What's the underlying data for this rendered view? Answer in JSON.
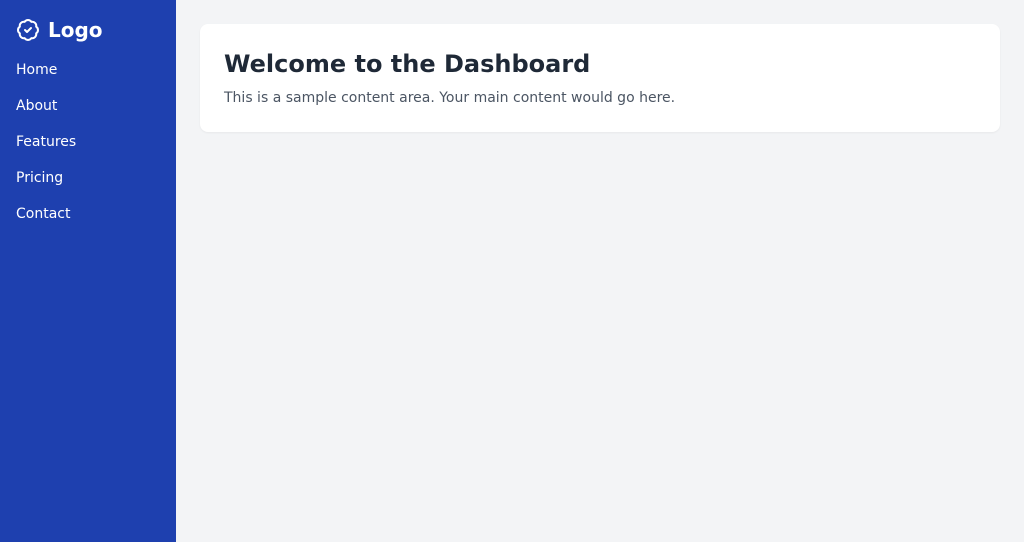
{
  "brand": {
    "label": "Logo"
  },
  "sidebar": {
    "items": [
      {
        "label": "Home"
      },
      {
        "label": "About"
      },
      {
        "label": "Features"
      },
      {
        "label": "Pricing"
      },
      {
        "label": "Contact"
      }
    ]
  },
  "main": {
    "title": "Welcome to the Dashboard",
    "description": "This is a sample content area. Your main content would go here."
  }
}
